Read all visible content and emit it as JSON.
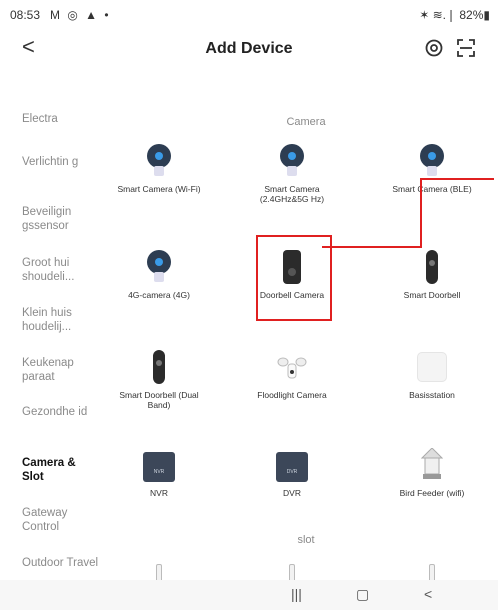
{
  "status_bar": {
    "time": "08:53",
    "left_icons": "M ◎ ▲ •",
    "right": "✶ ≋.❘ 82%▮"
  },
  "header": {
    "back": "<",
    "title": "Add Device"
  },
  "sidebar": [
    "Electra",
    "Verlichtin g",
    "Beveiligin gssensor",
    "Groot hui shoudeli...",
    "Klein huis houdelij...",
    "Keukenap paraat",
    "Gezondhe id",
    "Camera & Slot",
    "Gateway Control",
    "Outdoor Travel"
  ],
  "active_category": "Camera & Slot",
  "sections": {
    "camera": "Camera",
    "slot": "slot"
  },
  "devices": [
    {
      "label": "Smart Camera (Wi-Fi)",
      "icon": "camera-icon"
    },
    {
      "label": "Smart Camera (2.4GHz&5G Hz)",
      "icon": "camera-icon"
    },
    {
      "label": "Smart Camera (BLE)",
      "icon": "camera-icon"
    },
    {
      "label": "4G-camera (4G)",
      "icon": "camera-icon"
    },
    {
      "label": "Doorbell Camera",
      "icon": "doorbell-icon"
    },
    {
      "label": "Smart Doorbell",
      "icon": "doorbell-icon"
    },
    {
      "label": "Smart Doorbell (Dual Band)",
      "icon": "doorbell-icon"
    },
    {
      "label": "Floodlight Camera",
      "icon": "floodlight-icon"
    },
    {
      "label": "Basisstation",
      "icon": "base-station-icon"
    },
    {
      "label": "NVR",
      "icon": "nvr-icon"
    },
    {
      "label": "DVR",
      "icon": "dvr-icon"
    },
    {
      "label": "Bird Feeder (wifi)",
      "icon": "bird-feeder-icon"
    }
  ],
  "recorder_text": {
    "nvr": "NVR",
    "dvr": "DVR"
  },
  "nav": {
    "recent": "|||",
    "home": "▢",
    "back": "<"
  },
  "colors": {
    "highlight": "#e02020",
    "active_text": "#111111",
    "inactive_text": "#8a8a8a"
  }
}
